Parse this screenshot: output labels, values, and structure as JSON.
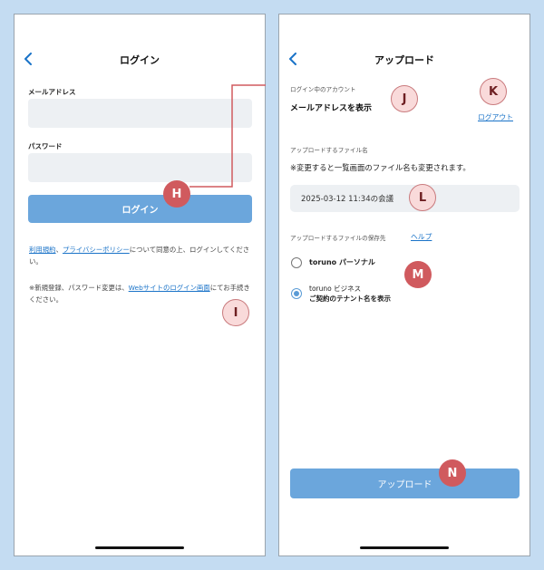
{
  "colors": {
    "background": "#c4dcf2",
    "primary_button": "#6ba6dc",
    "input_bg": "#edf0f3",
    "link": "#1a73c8",
    "marker": "#d05a5e",
    "marker_light": "#f9dada"
  },
  "login_screen": {
    "title": "ログイン",
    "back_icon": "chevron-left-icon",
    "email_label": "メールアドレス",
    "email_value": "",
    "password_label": "パスワード",
    "password_value": "",
    "login_button": "ログイン",
    "terms": {
      "link_terms": "利用規約",
      "sep": "、",
      "link_privacy": "プライバシーポリシー",
      "text_after": "について同意の上、ログインしてください。"
    },
    "register_note": {
      "text_before": "※新規登録、パスワード変更は、",
      "link": "Webサイトのログイン画面",
      "text_after": "にてお手続きください。"
    }
  },
  "upload_screen": {
    "title": "アップロード",
    "back_icon": "chevron-left-icon",
    "account_label": "ログイン中のアカウント",
    "account_value": "メールアドレスを表示",
    "logout_link": "ログアウト",
    "filename_label": "アップロードするファイル名",
    "filename_note": "※変更すると一覧画面のファイル名も変更されます。",
    "filename_value": "2025-03-12 11:34の会議",
    "destination_label": "アップロードするファイルの保存先",
    "help_link": "ヘルプ",
    "options": [
      {
        "label": "toruno パーソナル",
        "sub": "",
        "checked": false
      },
      {
        "label": "toruno ビジネス",
        "sub": "ご契約のテナント名を表示",
        "checked": true
      }
    ],
    "upload_button": "アップロード"
  },
  "markers": {
    "H": "H",
    "I": "I",
    "J": "J",
    "K": "K",
    "L": "L",
    "M": "M",
    "N": "N"
  }
}
